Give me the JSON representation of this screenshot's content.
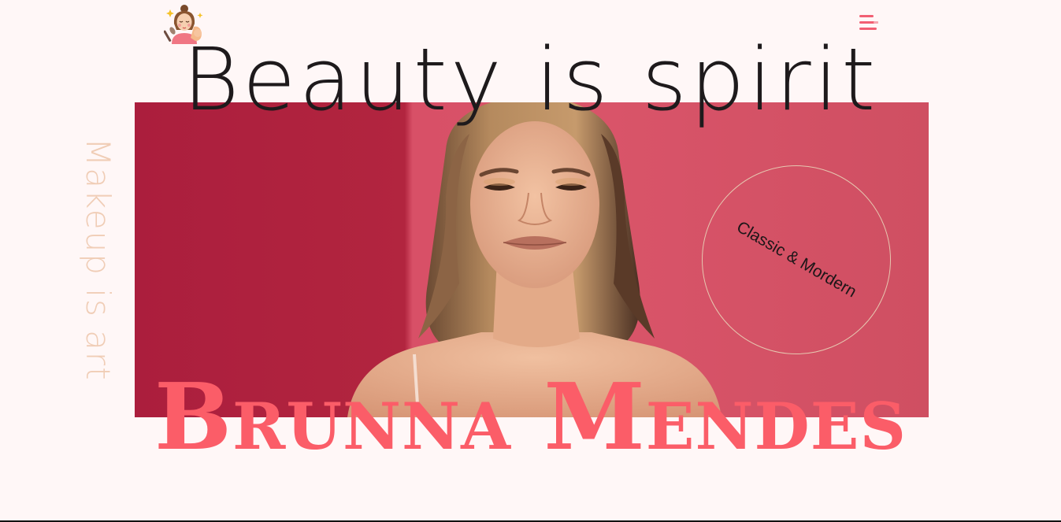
{
  "header": {
    "logo_icon": "makeup-artist-icon",
    "menu_icon": "hamburger-menu-icon"
  },
  "hero": {
    "headline": "Beauty is spirit",
    "vertical_tagline": "Makeup is art",
    "badge_text": "Classic & Mordern",
    "name": "Brunna Mendes",
    "photo_icon": "model-portrait-image"
  },
  "colors": {
    "background": "#fff7f7",
    "accent": "#fb5d68",
    "menu": "#f25f73",
    "tagline": "#f0cdb6",
    "hero_left": "#ab1e3d",
    "hero_right": "#d85067"
  }
}
